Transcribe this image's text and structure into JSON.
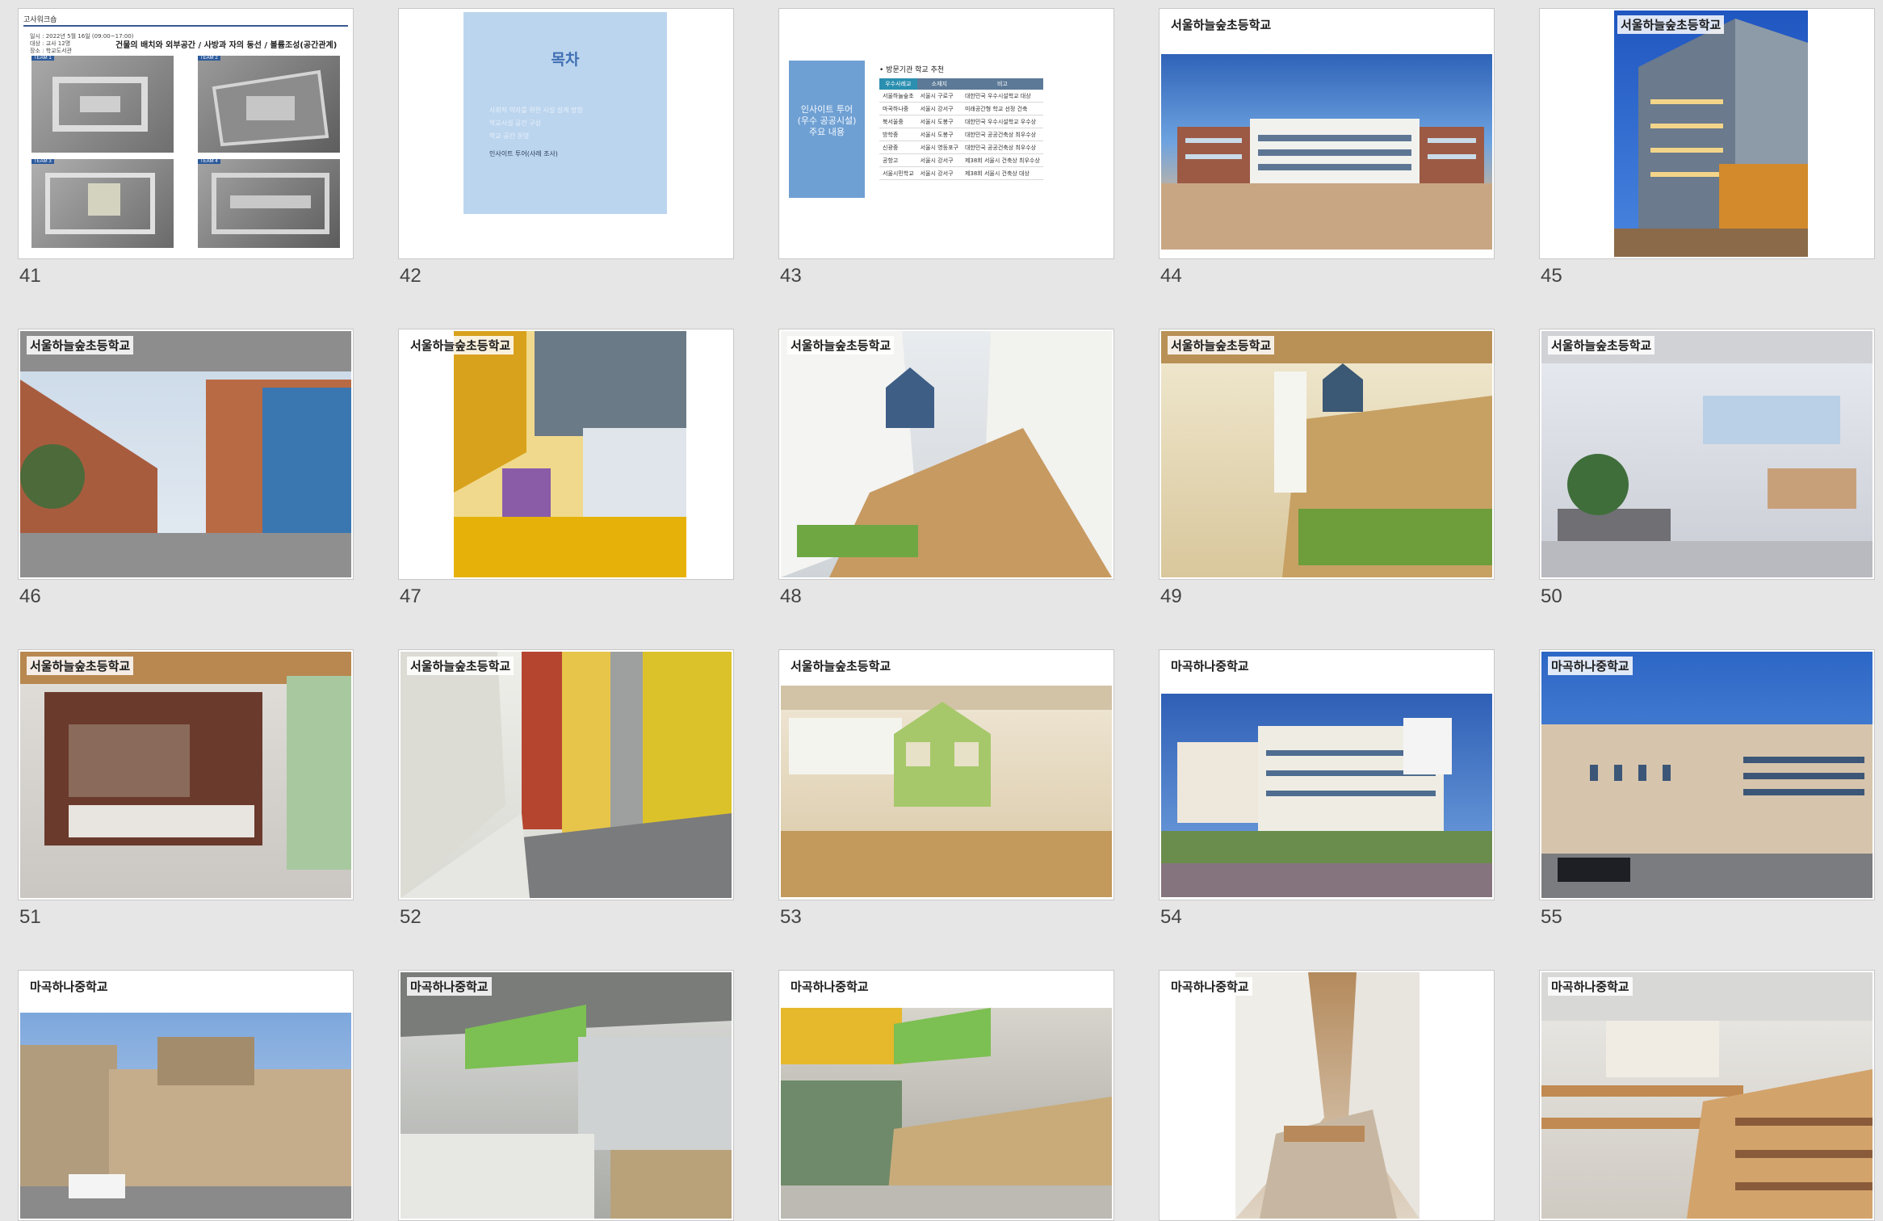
{
  "slides": [
    {
      "number": "41",
      "kind": "survey",
      "header": "고사워크숍",
      "info": [
        "일시 : 2022년 5월 16일 (09:00~17:00)",
        "대상 : 교사 12명",
        "장소 : 학교도서관"
      ],
      "title": "건물의 배치와 외부공간 / 사방과 자의 동선 / 볼륨조성(공간관계)",
      "teams": [
        "TEAM 1",
        "TEAM 2",
        "TEAM 3",
        "TEAM 4"
      ]
    },
    {
      "number": "42",
      "kind": "toc",
      "heading": "목차",
      "items": [
        "사회적 약자를 위한 시설 설계 방향",
        "학교시설 공간 구성",
        "학교 공간 운영",
        "인사이트 투어(사례 조사)"
      ]
    },
    {
      "number": "43",
      "kind": "table",
      "card": "인사이트 투어 (우수 공공시설) 주요 내용",
      "heading": "• 방문기관 학교 추천",
      "columns": [
        "우수사례교",
        "소재지",
        "비고"
      ],
      "rows": [
        [
          "서울하늘숲초",
          "서울시 구로구",
          "대한민국 우수시설학교 대상"
        ],
        [
          "마곡하나중",
          "서울시 강서구",
          "미래공간형 학교 선정 건축"
        ],
        [
          "북서울중",
          "서울시 도봉구",
          "대한민국 우수시설학교 우수상"
        ],
        [
          "방학중",
          "서울시 도봉구",
          "대한민국 공공건축상 최우수상"
        ],
        [
          "신광중",
          "서울시 영등포구",
          "대한민국 공공건축상 최우수상"
        ],
        [
          "공항고",
          "서울시 강서구",
          "제38회 서울시 건축상 최우수상"
        ],
        [
          "서울시민학교",
          "서울시 강서구",
          "제38회 서울시 건축상 대상"
        ]
      ]
    },
    {
      "number": "44",
      "kind": "photo",
      "label": "서울하늘숲초등학교",
      "scene": "school-exterior-front"
    },
    {
      "number": "45",
      "kind": "photo",
      "label": "서울하늘숲초등학교",
      "scene": "school-night-corner"
    },
    {
      "number": "46",
      "kind": "photo",
      "label": "서울하늘숲초등학교",
      "scene": "brick-courtyard"
    },
    {
      "number": "47",
      "kind": "photo",
      "label": "서울하늘숲초등학교",
      "scene": "yellow-atrium"
    },
    {
      "number": "48",
      "kind": "photo",
      "label": "서울하늘숲초등학교",
      "scene": "stair-house"
    },
    {
      "number": "49",
      "kind": "photo",
      "label": "서울하늘숲초등학교",
      "scene": "stair-lobby"
    },
    {
      "number": "50",
      "kind": "photo",
      "label": "서울하늘숲초등학교",
      "scene": "office-room"
    },
    {
      "number": "51",
      "kind": "photo",
      "label": "서울하늘숲초등학교",
      "scene": "lounge-counter"
    },
    {
      "number": "52",
      "kind": "photo",
      "label": "서울하늘숲초등학교",
      "scene": "corridor-yellow"
    },
    {
      "number": "53",
      "kind": "photo",
      "label": "서울하늘숲초등학교",
      "scene": "classroom-house"
    },
    {
      "number": "54",
      "kind": "photo",
      "label": "마곡하나중학교",
      "scene": "school-exterior-garden"
    },
    {
      "number": "55",
      "kind": "photo",
      "label": "마곡하나중학교",
      "scene": "school-exterior-street"
    },
    {
      "number": "56",
      "kind": "photo",
      "label": "마곡하나중학교",
      "scene": "street-view"
    },
    {
      "number": "57",
      "kind": "photo",
      "label": "마곡하나중학교",
      "scene": "atrium-banner"
    },
    {
      "number": "58",
      "kind": "photo",
      "label": "마곡하나중학교",
      "scene": "atrium-stairs"
    },
    {
      "number": "59",
      "kind": "photo",
      "label": "마곡하나중학교",
      "scene": "atrium-vertical"
    },
    {
      "number": "60",
      "kind": "photo",
      "label": "마곡하나중학교",
      "scene": "library-shelves"
    }
  ],
  "colors": {
    "background": "#e6e6e6",
    "accent_blue": "#bcd5ee",
    "table_header": "#5c7a97"
  }
}
